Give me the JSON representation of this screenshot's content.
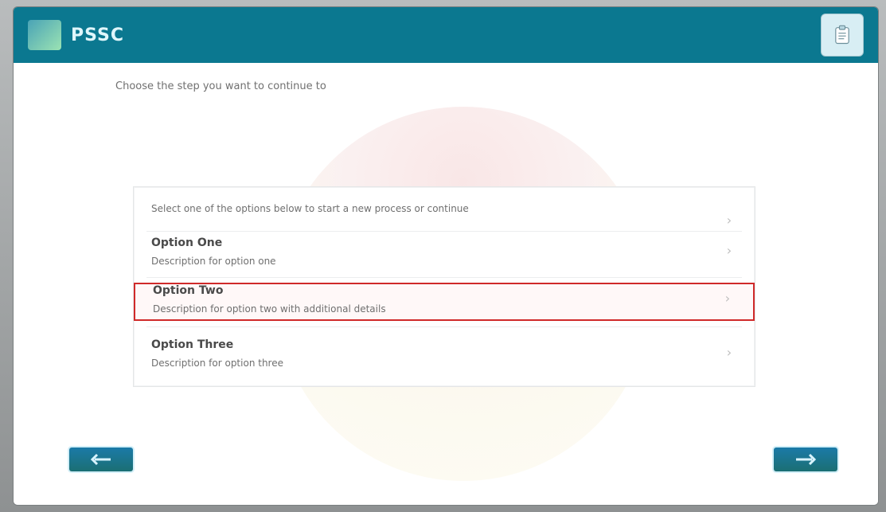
{
  "window": {
    "title": "PSSC",
    "icons": {
      "logo": "app-logo",
      "right": "clipboard-icon"
    }
  },
  "header": {
    "text": "Choose the step you want to continue to"
  },
  "list": {
    "items": [
      {
        "title": "",
        "subtitle": "Select one of the options below to start a new process or continue"
      },
      {
        "title": "Option One",
        "subtitle": "Description for option one"
      },
      {
        "title": "Option Two",
        "subtitle": "Description for option two with additional details"
      },
      {
        "title": "Option Three",
        "subtitle": "Description for option three"
      }
    ],
    "selected_index": 2
  },
  "navigation": {
    "back_icon": "left-arrow-icon",
    "next_icon": "right-arrow-icon"
  },
  "colors": {
    "titlebar": "#0b7890",
    "selection": "#d02a2a",
    "navButton": "#1b7aa8"
  }
}
